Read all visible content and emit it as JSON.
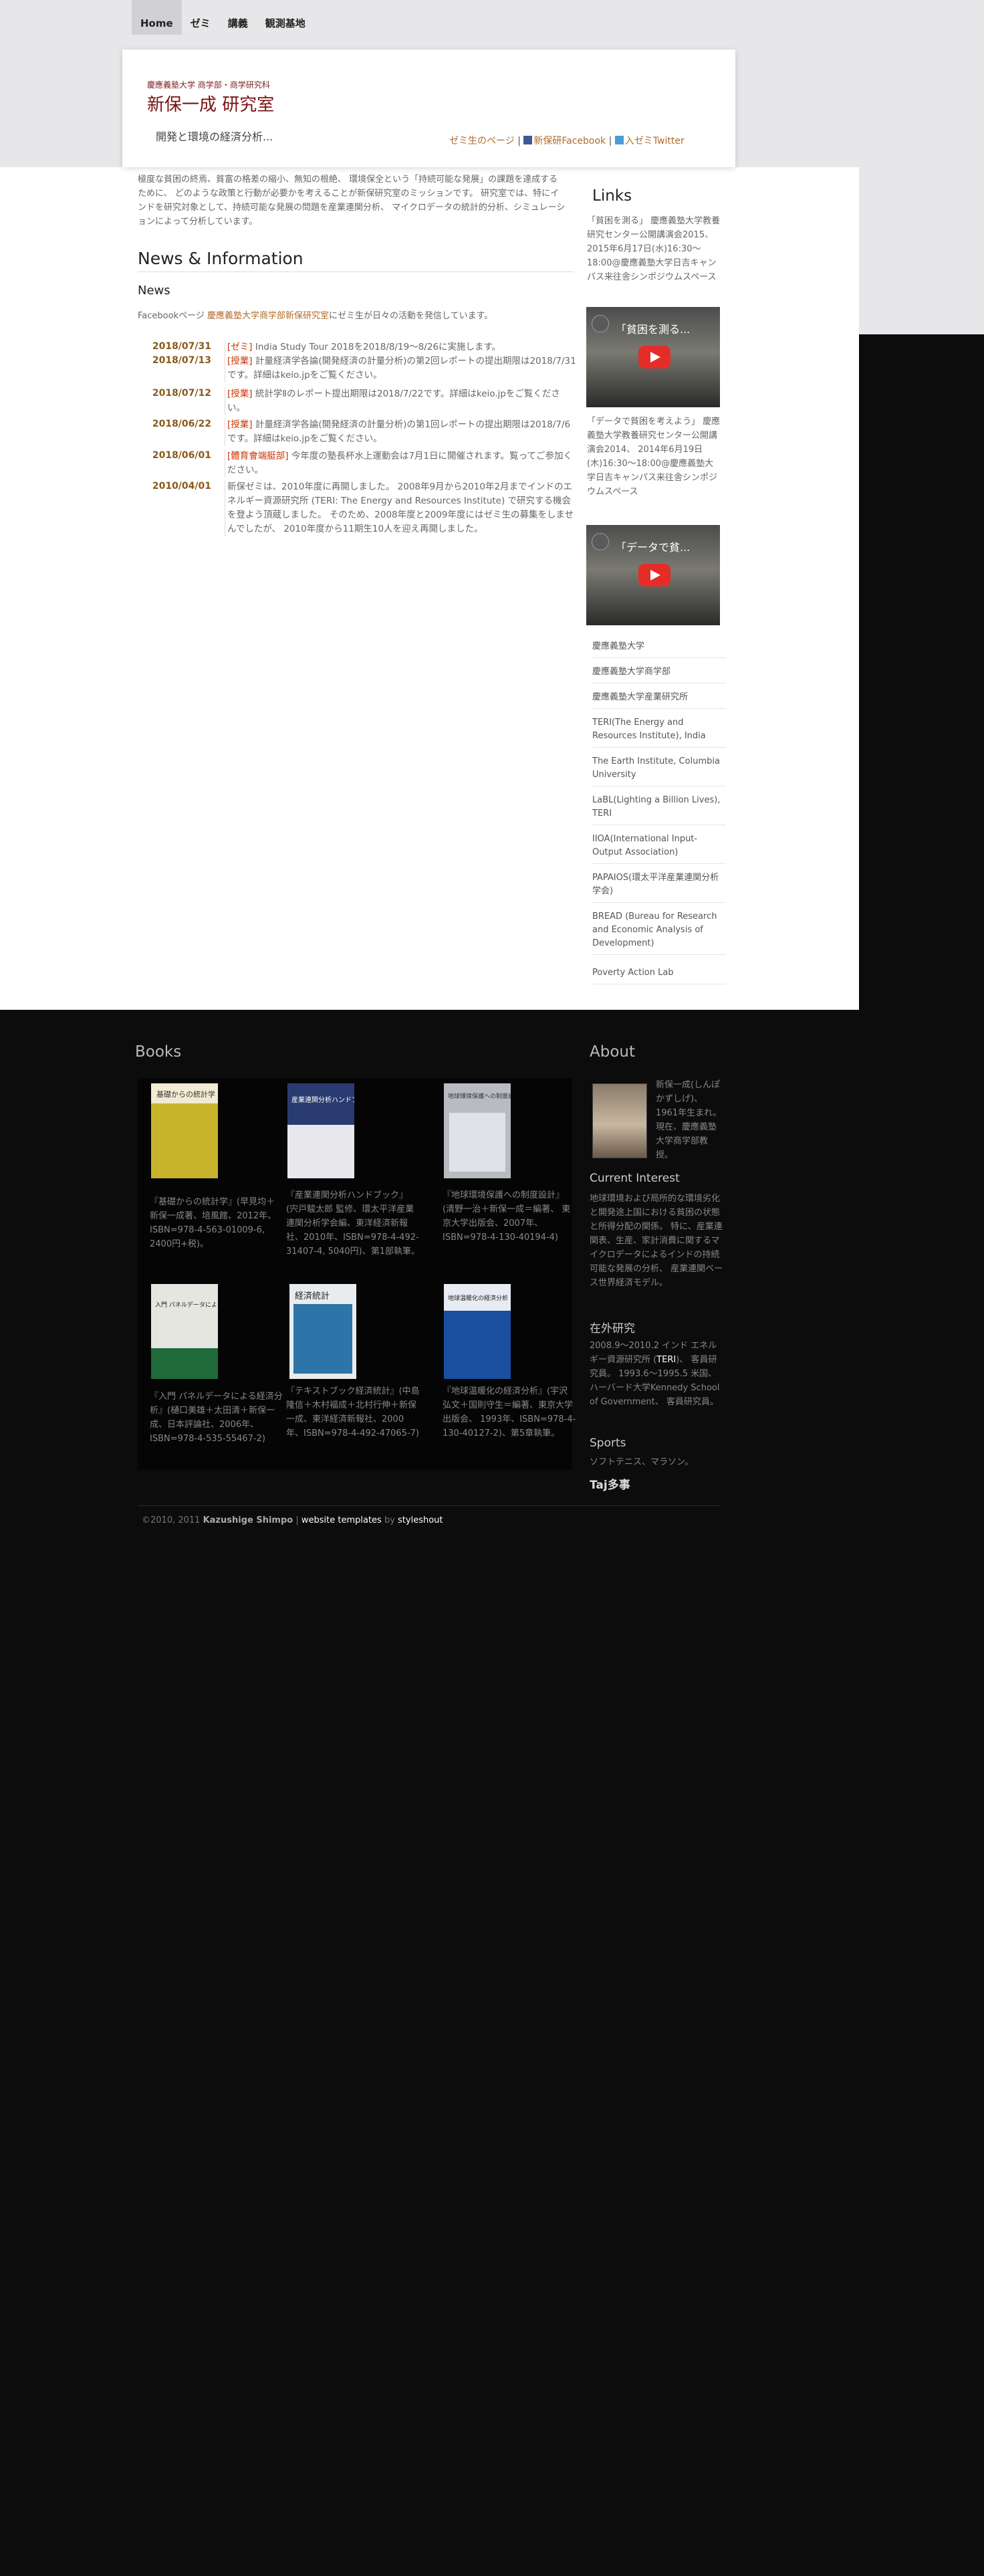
{
  "nav": [
    "Home",
    "ゼミ",
    "講義",
    "観測基地"
  ],
  "header": {
    "institution": "慶應義塾大学 商学部・商学研究科",
    "lab_title": "新保一成 研究室",
    "tagline": "開発と環境の経済分析...",
    "links": [
      "ゼミ生のページ",
      "新保研Facebook",
      "入ゼミTwitter"
    ],
    "separator": "|"
  },
  "intro": "極度な貧困の終焉、貧富の格差の縮小、無知の根絶、 環境保全という「持続可能な発展」の課題を達成するために、 どのような政策と行動が必要かを考えることが新保研究室のミッションです。 研究室では、特にインドを研究対象として、持続可能な発展の問題を産業連関分析、 マイクロデータの統計的分析、シミュレーションによって分析しています。",
  "news": {
    "heading": "News & Information",
    "sub": "News",
    "fb_prefix": "Facebookページ ",
    "fb_link": "慶應義塾大学商学部新保研究室",
    "fb_suffix": "にゼミ生が日々の活動を発信しています。",
    "items": [
      {
        "date": "2018/07/31",
        "tag": "[ゼミ]",
        "text": " India Study Tour 2018を2018/8/19〜8/26に実施します。"
      },
      {
        "date": "2018/07/13",
        "tag": "[授業]",
        "text": " 計量経済学各論(開発経済の計量分析)の第2回レポートの提出期限は2018/7/31です。詳細はkeio.jpをご覧ください。"
      },
      {
        "date": "2018/07/12",
        "tag": "[授業]",
        "text": " 統計学Ⅱのレポート提出期限は2018/7/22です。詳細はkeio.jpをご覧ください。"
      },
      {
        "date": "2018/06/22",
        "tag": "[授業]",
        "text": " 計量経済学各論(開発経済の計量分析)の第1回レポートの提出期限は2018/7/6です。詳細はkeio.jpをご覧ください。"
      },
      {
        "date": "2018/06/01",
        "tag": "[體育會端艇部]",
        "text": " 今年度の塾長杯水上運動会は7月1日に開催されます。覧ってご参加ください。"
      },
      {
        "date": "2010/04/01",
        "tag": "",
        "text": "新保ゼミは、2010年度に再開しました。 2008年9月から2010年2月までインドのエネルギー資源研究所 (TERI: The Energy and Resources Institute) で研究する機会を登よう頂蔵しました。 そのため、2008年度と2009年度にはゼミ生の募集をしませんでしたが、 2010年度から11期生10人を迎え再開しました。"
      }
    ]
  },
  "sidebar": {
    "event1": "「貧困を測る」 慶應義塾大学教養研究センター公開講演会2015、 2015年6月17日(水)16:30〜18:00@慶應義塾大学日吉キャンパス来往舎シンポジウムスペース",
    "video1_title": "「貧困を測る...",
    "event2": "「データで貧困を考えよう」 慶應義塾大学教養研究センター公開講演会2014、 2014年6月19日(木)16:30〜18:00@慶應義塾大学日吉キャンパス来往舎シンポジウムスペース",
    "video2_title": "「データで貧...",
    "links_heading": "Links",
    "links": [
      "慶應義塾大学",
      "慶應義塾大学商学部",
      "慶應義塾大学産業研究所",
      "TERI(The Energy and Resources Institute), India",
      "The Earth Institute, Columbia University",
      "LaBL(Lighting a Billion Lives), TERI",
      "IIOA(International Input-Output Association)",
      "PAPAIOS(環太平洋産業連関分析学会)",
      "BREAD (Bureau for Research and Economic Analysis of Development)",
      "Poverty Action Lab"
    ]
  },
  "books": {
    "heading": "Books",
    "items": [
      {
        "caption": "『基礎からの統計学』(早見均＋新保一成著、培風館、2012年、ISBN=978-4-563-01009-6, 2400円+税)。",
        "cover": "#c8b42c",
        "cover_title": "基礎からの統計学"
      },
      {
        "caption": "『産業連関分析ハンドブック』(宍戸駿太郎 監修、環太平洋産業連関分析学会編、東洋経済新報社、2010年、ISBN=978-4-492-31407-4, 5040円)、第1部執筆。",
        "cover": "#2a3b72",
        "cover_title": "産業連関分析ハンドブック"
      },
      {
        "caption": "『地球環境保護への制度設計』(清野一治＋新保一成＝編著、 東京大学出版会、2007年、ISBN=978-4-130-40194-4)",
        "cover": "#b8bcc2",
        "cover_title": "地球環境保護への制度設計"
      },
      {
        "caption": "『入門 パネルデータによる経済分析』(樋口美雄＋太田清＋新保一成、日本評論社、2006年、ISBN=978-4-535-55467-2)",
        "cover": "#1f6b3a",
        "cover_title": "入門 パネルデータによる経済分析"
      },
      {
        "caption": "『テキストブック経済統計』(中島隆信＋木村福成＋北村行伸＋新保 一成、東洋経済新報社、2000年、ISBN=978-4-492-47065-7)",
        "cover": "#2d74a8",
        "cover_title": "経済統計"
      },
      {
        "caption": "『地球温暖化の経済分析』(宇沢弘文＋国則守生＝編著、東京大学出版会、 1993年、ISBN=978-4-130-40127-2)、第5章執筆。",
        "cover": "#1a4fa0",
        "cover_title": "地球温暖化の経済分析"
      }
    ]
  },
  "about": {
    "heading": "About",
    "text": "新保一成(しんぽ かずしげ)、1961年生まれ。現在、慶應義塾大学商学部教授。",
    "interest_title": "Current Interest",
    "interest": "地球環境および局所的な環境劣化と開発途上国における貧困の状態と所得分配の関係。 特に、産業連関表、生産、家計消費に関するマイクロデータによるインドの持続可能な発展の分析、 産業連関ベース世界経済モデル。",
    "abroad_title": "在外研究",
    "abroad_pre": "2008.9〜2010.2 インド エネルギー資源研究所 (",
    "abroad_teri": "TERI",
    "abroad_post": ")、 客員研究員。 1993.6〜1995.5 米国、 ハーバード大学Kennedy School of Government、 客員研究員。",
    "sports_title": "Sports",
    "sports": "ソフトテニス、マラソン。",
    "taj": "Taj多事"
  },
  "footer": {
    "copy": "©2010, 2011 ",
    "name": "Kazushige Shimpo",
    "sep": " | ",
    "templates": "website templates",
    "by": " by ",
    "author": "styleshout"
  }
}
